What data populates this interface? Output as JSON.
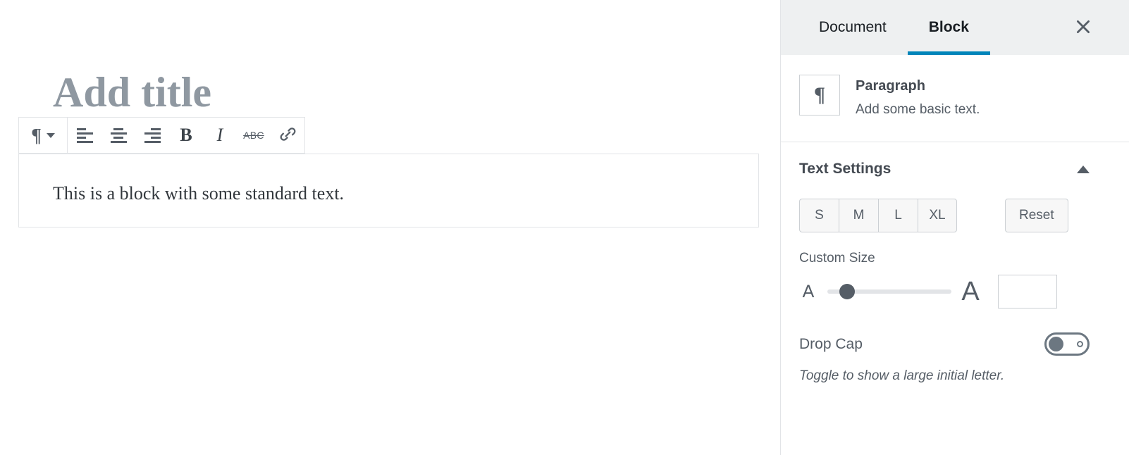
{
  "editor": {
    "title_placeholder": "Add title",
    "block_text": "This is a block with some standard text.",
    "toolbar": {
      "block_type_label": "Paragraph block type",
      "block_type_icon": "pilcrow-icon",
      "dropdown_icon": "chevron-down-icon",
      "buttons": [
        {
          "name": "align-left",
          "icon": "align-left-icon",
          "label": "Align text left"
        },
        {
          "name": "align-center",
          "icon": "align-center-icon",
          "label": "Align text center"
        },
        {
          "name": "align-right",
          "icon": "align-right-icon",
          "label": "Align text right"
        },
        {
          "name": "bold",
          "icon": "bold-icon",
          "label": "B"
        },
        {
          "name": "italic",
          "icon": "italic-icon",
          "label": "I"
        },
        {
          "name": "strikethrough",
          "icon": "strikethrough-icon",
          "label": "ABC"
        },
        {
          "name": "link",
          "icon": "link-icon",
          "label": "Link"
        }
      ]
    }
  },
  "sidebar": {
    "tabs": [
      {
        "label": "Document",
        "active": false
      },
      {
        "label": "Block",
        "active": true
      }
    ],
    "close_label": "Close settings",
    "close_icon": "close-icon",
    "block_card": {
      "icon": "pilcrow-icon",
      "title": "Paragraph",
      "description": "Add some basic text."
    },
    "text_settings": {
      "title": "Text Settings",
      "collapse_icon": "triangle-up-icon",
      "preset_sizes": [
        "S",
        "M",
        "L",
        "XL"
      ],
      "reset_label": "Reset",
      "custom_size_label": "Custom Size",
      "small_a": "A",
      "large_a": "A",
      "slider_value_percent": 11,
      "custom_size_value": "",
      "custom_size_placeholder": "",
      "drop_cap_label": "Drop Cap",
      "drop_cap_state": "off",
      "drop_cap_help": "Toggle to show a large initial letter."
    }
  },
  "colors": {
    "accent": "#0085ba",
    "header_bg": "#eef0f1",
    "border": "#e2e4e7",
    "icon": "#555d66",
    "placeholder_title": "#8f98a1"
  }
}
